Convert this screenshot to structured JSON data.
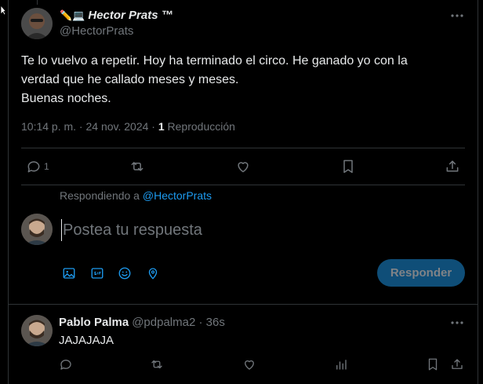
{
  "tweet": {
    "author_emoji": "✏️💻",
    "author_name": "Hector Prats ™",
    "author_handle": "@HectorPrats",
    "text": "Te lo vuelvo a repetir. Hoy ha terminado el circo. He ganado yo con la\nverdad que he callado meses y meses.\nBuenas noches.",
    "time": "10:14 p. m. · 24 nov. 2024 ·",
    "views_count": "1",
    "views_label": "Reproducción",
    "reply_count": "1"
  },
  "composer": {
    "replying_prefix": "Respondiendo a",
    "replying_handle": "@HectorPrats",
    "placeholder": "Postea tu respuesta",
    "submit_label": "Responder",
    "tool_icons": [
      "image-icon",
      "gif-icon",
      "emoji-icon",
      "location-icon"
    ]
  },
  "reply": {
    "name": "Pablo Palma",
    "handle": "@pdpalma2 · 36s",
    "text": "JAJAJAJA"
  },
  "colors": {
    "background": "#000000",
    "text": "#e7e9ea",
    "muted": "#71767b",
    "accent": "#1d9bf0",
    "button_disabled": "#0f4e78"
  }
}
